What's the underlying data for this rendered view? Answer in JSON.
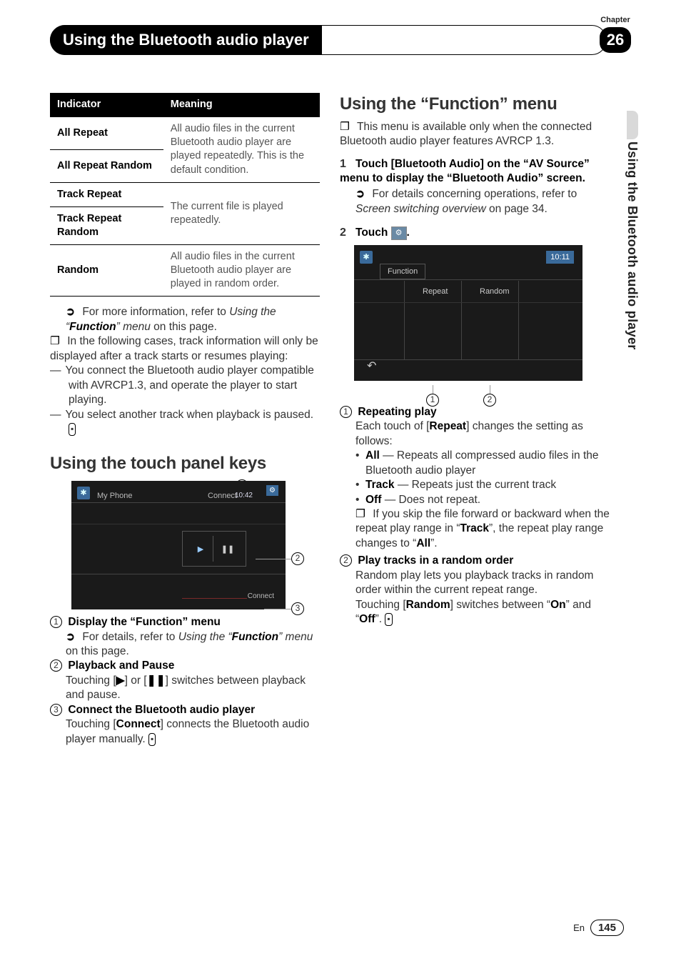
{
  "header": {
    "chapter_label": "Chapter",
    "chapter_number": "26",
    "title": "Using the Bluetooth audio player",
    "side_tab": "Using the Bluetooth audio player"
  },
  "table": {
    "head_indicator": "Indicator",
    "head_meaning": "Meaning",
    "rows": [
      {
        "indicator": "All Repeat",
        "meaning_split_top": "All audio files in the current"
      },
      {
        "indicator": "All Repeat Random",
        "meaning_split_bottom": "Bluetooth audio player are played repeatedly. This is the default condition."
      },
      {
        "indicator": "Track Repeat",
        "meaning_split_top2": ""
      },
      {
        "indicator": "Track Repeat Random",
        "meaning_shared2": "The current file is played repeatedly."
      },
      {
        "indicator": "Random",
        "meaning": "All audio files in the current Bluetooth audio player are played in random order."
      }
    ]
  },
  "left": {
    "ref1_a": "For more information, refer to ",
    "ref1_b": "Using the “",
    "ref1_c": "Function",
    "ref1_d": "” menu",
    "ref1_e": " on this page.",
    "note1": "In the following cases, track information will only be displayed after a track starts or resumes playing:",
    "dash1": "You connect the Bluetooth audio player compatible with AVRCP1.3, and operate the player to start playing.",
    "dash2": "You select another track when playback is paused.",
    "h2_touch": "Using the touch panel keys",
    "shot1": {
      "device": "My Phone",
      "connect": "Connect",
      "time": "10:42",
      "connect2": "Connect"
    },
    "k1_title": "Display the “Function” menu",
    "k1_ref_a": "For details, refer to ",
    "k1_ref_b": "Using the “",
    "k1_ref_c": "Function",
    "k1_ref_d": "” menu",
    "k1_ref_e": " on this page.",
    "k2_title": "Playback and Pause",
    "k2_body_a": "Touching [",
    "k2_body_b": "] or [",
    "k2_body_c": "] switches between playback and pause.",
    "k3_title": "Connect the Bluetooth audio player",
    "k3_body_a": "Touching [",
    "k3_body_b": "Connect",
    "k3_body_c": "] connects the Bluetooth audio player manually."
  },
  "right": {
    "h2_func": "Using the “Function” menu",
    "note_top": "This menu is available only when the connected Bluetooth audio player features AVRCP 1.3.",
    "step1": "Touch [Bluetooth Audio] on the “AV Source” menu to display the “Bluetooth Audio” screen.",
    "step1_ref_a": "For details concerning operations, refer to ",
    "step1_ref_b": "Screen switching overview",
    "step1_ref_c": " on page 34.",
    "step2_a": "Touch ",
    "step2_b": ".",
    "shot2": {
      "function": "Function",
      "repeat": "Repeat",
      "random": "Random",
      "time": "10:11"
    },
    "r1_title": "Repeating play",
    "r1_body_a": "Each touch of [",
    "r1_body_b": "Repeat",
    "r1_body_c": "] changes the setting as follows:",
    "r1_all_a": "All",
    "r1_all_b": " — Repeats all compressed audio files in the Bluetooth audio player",
    "r1_track_a": "Track",
    "r1_track_b": " — Repeats just the current track",
    "r1_off_a": "Off",
    "r1_off_b": " — Does not repeat.",
    "r1_note_a": "If you skip the file forward or backward when the repeat play range in “",
    "r1_note_b": "Track",
    "r1_note_c": "”, the repeat play range changes to “",
    "r1_note_d": "All",
    "r1_note_e": "”.",
    "r2_title": "Play tracks in a random order",
    "r2_body": "Random play lets you playback tracks in random order within the current repeat range.",
    "r2_body2_a": "Touching [",
    "r2_body2_b": "Random",
    "r2_body2_c": "] switches between “",
    "r2_body2_d": "On",
    "r2_body2_e": "” and “",
    "r2_body2_f": "Off",
    "r2_body2_g": "”."
  },
  "footer": {
    "lang": "En",
    "page": "145"
  }
}
